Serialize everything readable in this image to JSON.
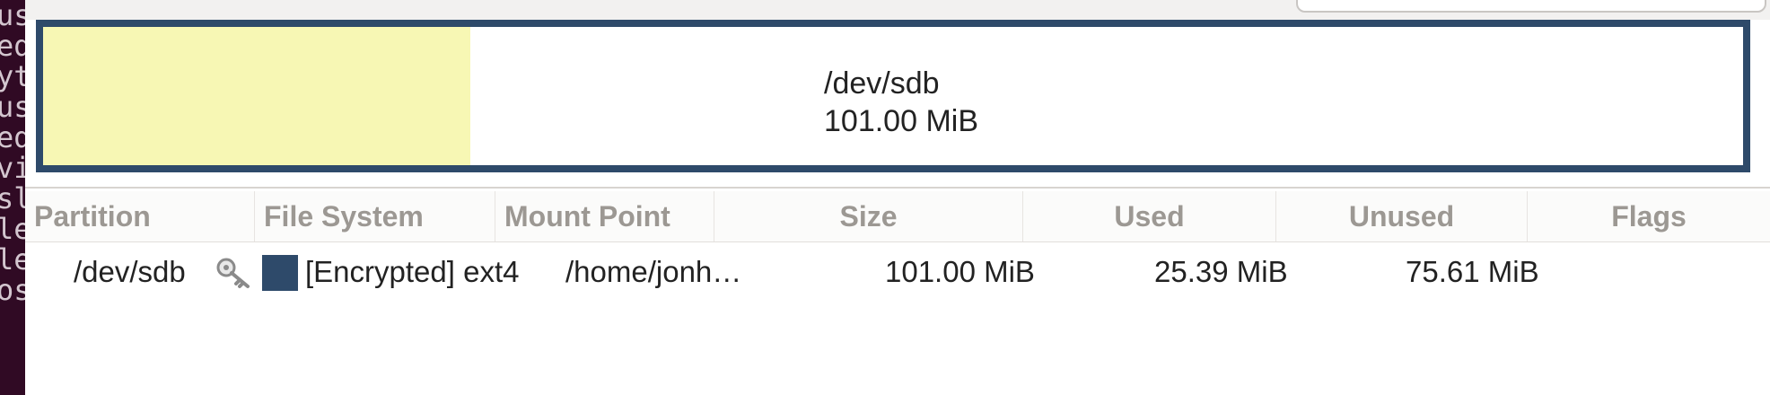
{
  "terminal": {
    "lines": [
      "us",
      "ed",
      "yt",
      "us",
      "ed",
      "vi",
      "sl",
      "le",
      "le",
      "os"
    ]
  },
  "disk": {
    "device": "/dev/sdb",
    "size": "101.00 MiB",
    "used_fraction": 0.2514,
    "colors": {
      "border": "#2e4a6a",
      "used": "#f7f7b4",
      "unused": "#ffffff"
    }
  },
  "table": {
    "columns": [
      "Partition",
      "File System",
      "Mount Point",
      "Size",
      "Used",
      "Unused",
      "Flags"
    ],
    "rows": [
      {
        "partition": "/dev/sdb",
        "partition_icon": "key-icon",
        "filesystem": "[Encrypted] ext4",
        "filesystem_color": "#2e4a6a",
        "mount_point": "/home/jonh…",
        "size": "101.00 MiB",
        "used": "25.39 MiB",
        "unused": "75.61 MiB",
        "flags": ""
      }
    ]
  }
}
